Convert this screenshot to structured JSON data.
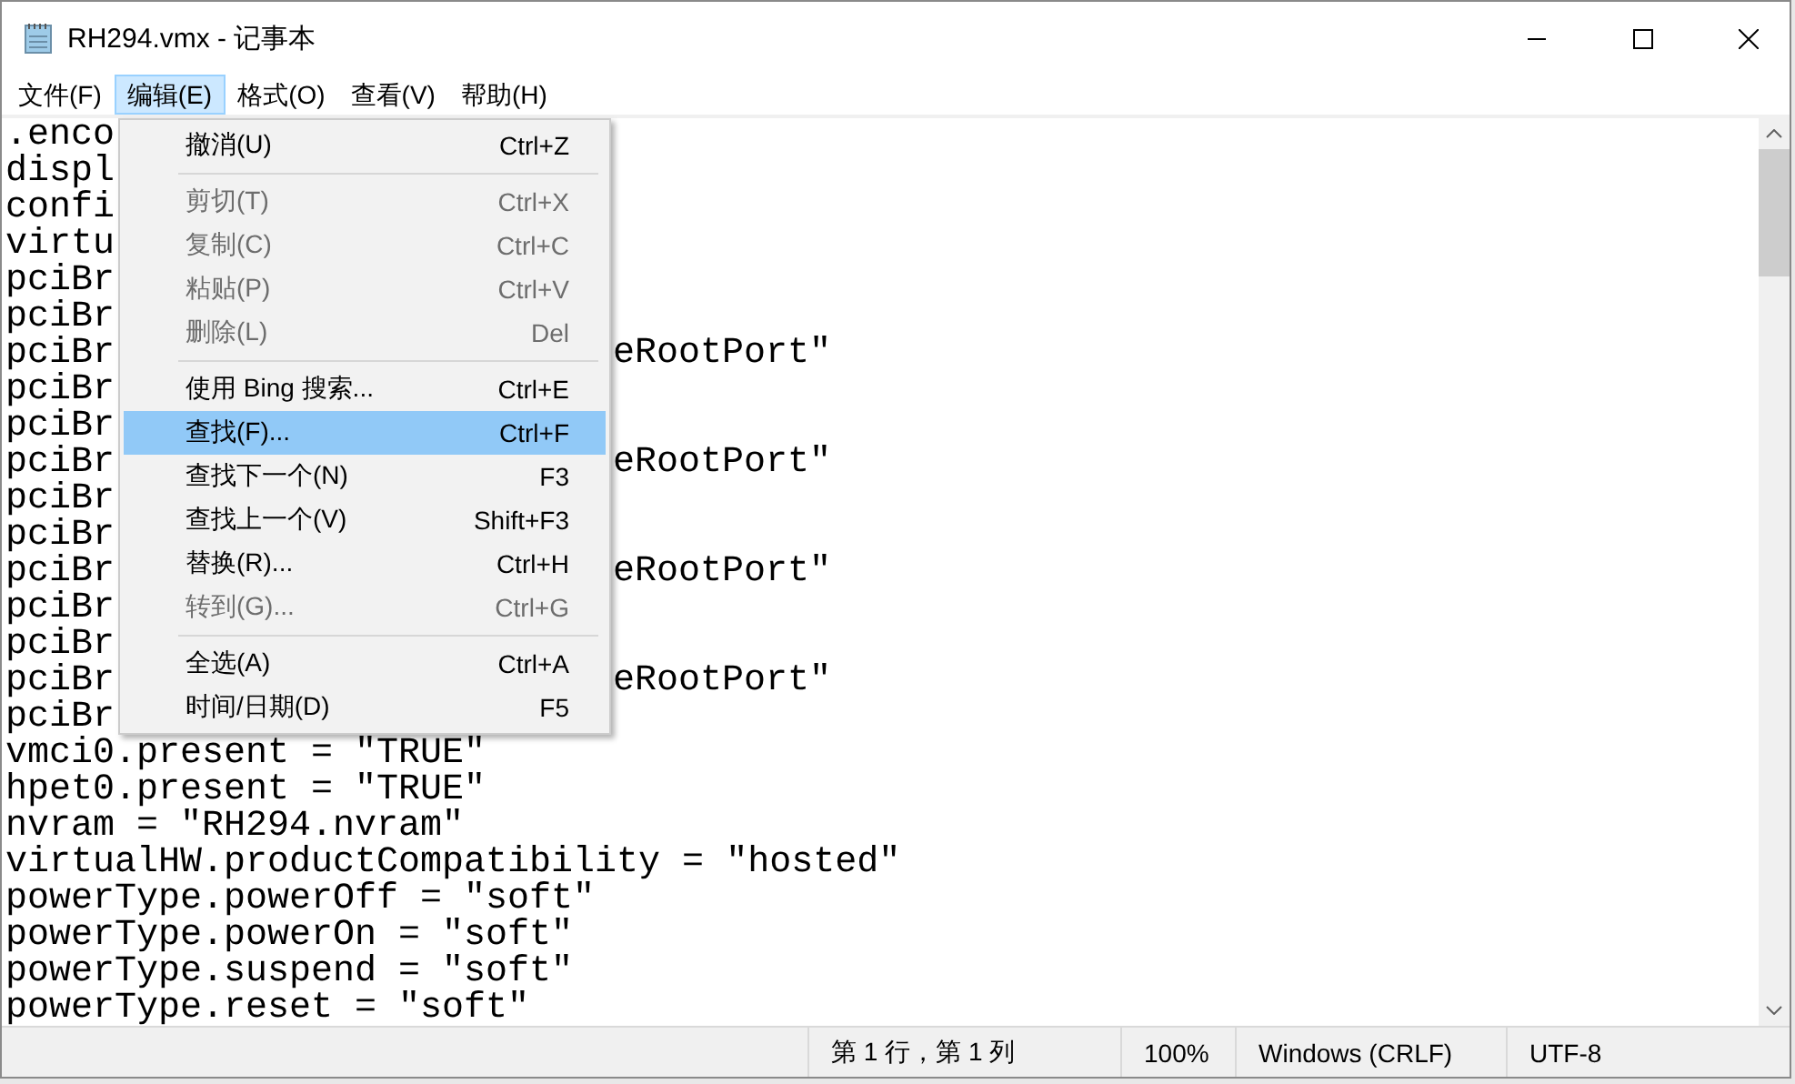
{
  "window": {
    "title": "RH294.vmx - 记事本"
  },
  "menu_bar": [
    {
      "label": "文件(F)",
      "selected": false
    },
    {
      "label": "编辑(E)",
      "selected": true
    },
    {
      "label": "格式(O)",
      "selected": false
    },
    {
      "label": "查看(V)",
      "selected": false
    },
    {
      "label": "帮助(H)",
      "selected": false
    }
  ],
  "editor_lines": [
    {
      "text": ".enco"
    },
    {
      "text": "displ"
    },
    {
      "text": "confi"
    },
    {
      "text": "virtu"
    },
    {
      "text": "pciBr"
    },
    {
      "text": "pciBr"
    },
    {
      "text": "pciBr",
      "tail": "eRootPort\""
    },
    {
      "text": "pciBr"
    },
    {
      "text": "pciBr"
    },
    {
      "text": "pciBr",
      "tail": "eRootPort\""
    },
    {
      "text": "pciBr"
    },
    {
      "text": "pciBr"
    },
    {
      "text": "pciBr",
      "tail": "eRootPort\""
    },
    {
      "text": "pciBr"
    },
    {
      "text": "pciBr"
    },
    {
      "text": "pciBr",
      "tail": "eRootPort\""
    },
    {
      "text": "pciBr"
    },
    {
      "text": "vmci0.present = \"TRUE\""
    },
    {
      "text": "hpet0.present = \"TRUE\""
    },
    {
      "text": "nvram = \"RH294.nvram\""
    },
    {
      "text": "virtualHW.productCompatibility = \"hosted\""
    },
    {
      "text": "powerType.powerOff = \"soft\""
    },
    {
      "text": "powerType.powerOn = \"soft\""
    },
    {
      "text": "powerType.suspend = \"soft\""
    },
    {
      "text": "powerType.reset = \"soft\""
    }
  ],
  "edit_menu": [
    {
      "kind": "item",
      "label": "撤消(U)",
      "shortcut": "Ctrl+Z",
      "disabled": false,
      "selected": false
    },
    {
      "kind": "separator"
    },
    {
      "kind": "item",
      "label": "剪切(T)",
      "shortcut": "Ctrl+X",
      "disabled": true,
      "selected": false
    },
    {
      "kind": "item",
      "label": "复制(C)",
      "shortcut": "Ctrl+C",
      "disabled": true,
      "selected": false
    },
    {
      "kind": "item",
      "label": "粘贴(P)",
      "shortcut": "Ctrl+V",
      "disabled": true,
      "selected": false
    },
    {
      "kind": "item",
      "label": "删除(L)",
      "shortcut": "Del",
      "disabled": true,
      "selected": false
    },
    {
      "kind": "separator"
    },
    {
      "kind": "item",
      "label": "使用 Bing 搜索...",
      "shortcut": "Ctrl+E",
      "disabled": false,
      "selected": false
    },
    {
      "kind": "item",
      "label": "查找(F)...",
      "shortcut": "Ctrl+F",
      "disabled": false,
      "selected": true
    },
    {
      "kind": "item",
      "label": "查找下一个(N)",
      "shortcut": "F3",
      "disabled": false,
      "selected": false
    },
    {
      "kind": "item",
      "label": "查找上一个(V)",
      "shortcut": "Shift+F3",
      "disabled": false,
      "selected": false
    },
    {
      "kind": "item",
      "label": "替换(R)...",
      "shortcut": "Ctrl+H",
      "disabled": false,
      "selected": false
    },
    {
      "kind": "item",
      "label": "转到(G)...",
      "shortcut": "Ctrl+G",
      "disabled": true,
      "selected": false
    },
    {
      "kind": "separator"
    },
    {
      "kind": "item",
      "label": "全选(A)",
      "shortcut": "Ctrl+A",
      "disabled": false,
      "selected": false
    },
    {
      "kind": "item",
      "label": "时间/日期(D)",
      "shortcut": "F5",
      "disabled": false,
      "selected": false
    }
  ],
  "status_bar": [
    "第 1 行，第 1 列",
    "100%",
    "Windows (CRLF)",
    "UTF-8"
  ]
}
